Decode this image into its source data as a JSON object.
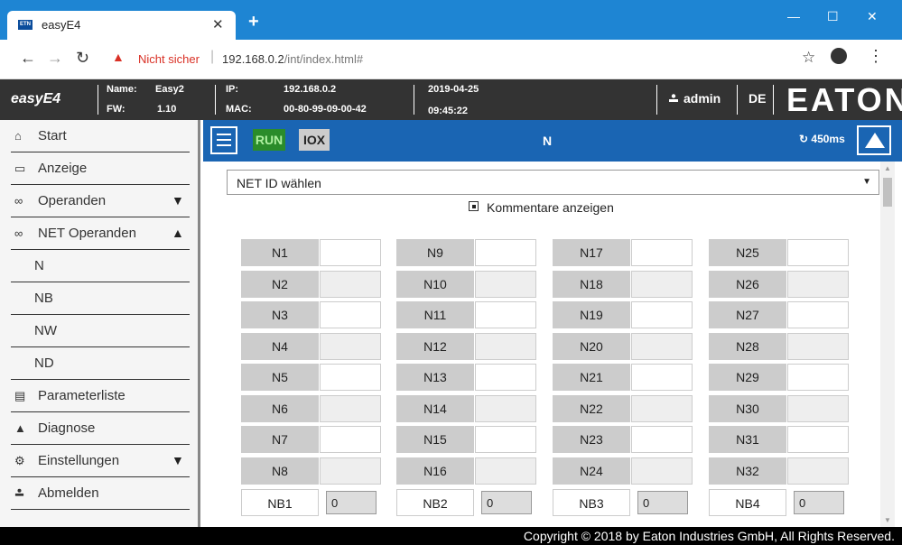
{
  "browser": {
    "tab_title": "easyE4",
    "favicon_text": "ETN",
    "security_label": "Nicht sicher",
    "url_host": "192.168.0.2",
    "url_path": "/int/index.html#"
  },
  "header": {
    "app_name": "easyE4",
    "name_label": "Name:",
    "name_value": "Easy2",
    "fw_label": "FW:",
    "fw_value": "1.10",
    "ip_label": "IP:",
    "ip_value": "192.168.0.2",
    "mac_label": "MAC:",
    "mac_value": "00-80-99-09-00-42",
    "date": "2019-04-25",
    "time": "09:45:22",
    "user": "admin",
    "language": "DE",
    "brand": "EATON"
  },
  "sidebar": {
    "items": [
      {
        "label": "Start",
        "icon": "home-icon"
      },
      {
        "label": "Anzeige",
        "icon": "monitor-icon"
      },
      {
        "label": "Operanden",
        "icon": "glasses-icon",
        "arrow": "▼"
      },
      {
        "label": "NET Operanden",
        "icon": "glasses-icon",
        "arrow": "▲"
      },
      {
        "label": "N"
      },
      {
        "label": "NB"
      },
      {
        "label": "NW"
      },
      {
        "label": "ND"
      },
      {
        "label": "Parameterliste",
        "icon": "list-icon"
      },
      {
        "label": "Diagnose",
        "icon": "warning-icon"
      },
      {
        "label": "Einstellungen",
        "icon": "gear-icon",
        "arrow": "▼"
      },
      {
        "label": "Abmelden",
        "icon": "user-icon"
      }
    ]
  },
  "toolbar": {
    "run": "RUN",
    "iox": "IOX",
    "title": "N",
    "cycle": "450ms"
  },
  "content": {
    "netid_placeholder": "NET ID wählen",
    "comment_label": "Kommentare anzeigen",
    "columns": [
      [
        "N1",
        "N2",
        "N3",
        "N4",
        "N5",
        "N6",
        "N7",
        "N8"
      ],
      [
        "N9",
        "N10",
        "N11",
        "N12",
        "N13",
        "N14",
        "N15",
        "N16"
      ],
      [
        "N17",
        "N18",
        "N19",
        "N20",
        "N21",
        "N22",
        "N23",
        "N24"
      ],
      [
        "N25",
        "N26",
        "N27",
        "N28",
        "N29",
        "N30",
        "N31",
        "N32"
      ]
    ],
    "nb": [
      {
        "label": "NB1",
        "value": "0"
      },
      {
        "label": "NB2",
        "value": "0"
      },
      {
        "label": "NB3",
        "value": "0"
      },
      {
        "label": "NB4",
        "value": "0"
      }
    ]
  },
  "footer": "Copyright © 2018 by Eaton Industries GmbH, All Rights Reserved."
}
